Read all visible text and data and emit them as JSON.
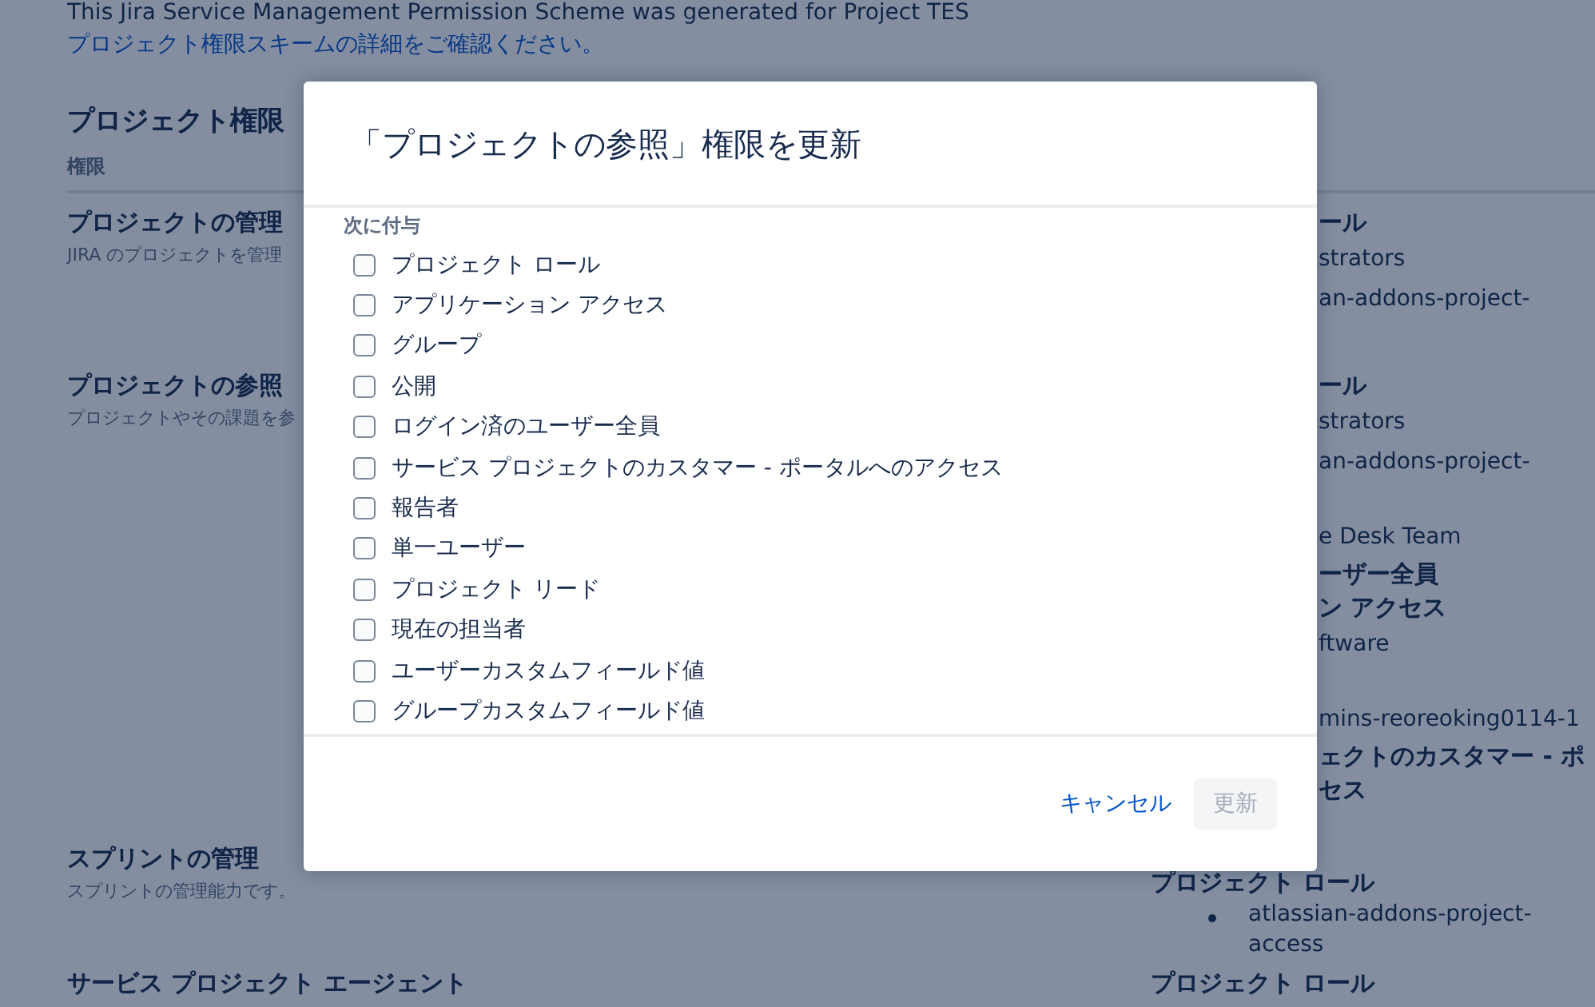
{
  "page": {
    "notice": "This Jira Service Management Permission Scheme was generated for Project TES",
    "notice_link": "プロジェクト権限スキームの詳細をご確認ください。",
    "heading": "プロジェクト権限",
    "column_header": "権限",
    "permissions": [
      {
        "name": "プロジェクトの管理",
        "description": "JIRA のプロジェクトを管理",
        "grants": [
          {
            "kind": "bold",
            "text": "ール"
          },
          {
            "kind": "plain",
            "text": "strators"
          },
          {
            "kind": "plain",
            "text": "an-addons-project-"
          }
        ]
      },
      {
        "name": "プロジェクトの参照",
        "description": "プロジェクトやその課題を参",
        "grants": [
          {
            "kind": "bold",
            "text": "ール"
          },
          {
            "kind": "plain",
            "text": "strators"
          },
          {
            "kind": "plain",
            "text": "an-addons-project-"
          },
          {
            "kind": "gap"
          },
          {
            "kind": "plain",
            "text": "e Desk Team"
          },
          {
            "kind": "bold",
            "text": "ーザー全員"
          },
          {
            "kind": "bold",
            "text": "ン アクセス"
          },
          {
            "kind": "plain",
            "text": "ftware"
          },
          {
            "kind": "gap"
          },
          {
            "kind": "plain",
            "text": "mins-reoreoking0114-1"
          },
          {
            "kind": "bold",
            "text": "ェクトのカスタマー - ポ"
          },
          {
            "kind": "bold",
            "text": "セス"
          }
        ]
      },
      {
        "name": "スプリントの管理",
        "description": "スプリントの管理能力です。",
        "grants": [
          {
            "kind": "bold",
            "text": "プロジェクト ロール"
          },
          {
            "kind": "bullet",
            "text": "atlassian-addons-project-access"
          }
        ]
      },
      {
        "name": "サービス プロジェクト エージェント",
        "grants": [
          {
            "kind": "bold",
            "text": "プロジェクト ロール"
          }
        ]
      }
    ]
  },
  "dialog": {
    "title": "「プロジェクトの参照」権限を更新",
    "section_label": "次に付与",
    "options": [
      {
        "label": "プロジェクト ロール",
        "checked": false
      },
      {
        "label": "アプリケーション アクセス",
        "checked": false
      },
      {
        "label": "グループ",
        "checked": false
      },
      {
        "label": "公開",
        "checked": false
      },
      {
        "label": "ログイン済のユーザー全員",
        "checked": false
      },
      {
        "label": "サービス プロジェクトのカスタマー - ポータルへのアクセス",
        "checked": false
      },
      {
        "label": "報告者",
        "checked": false
      },
      {
        "label": "単一ユーザー",
        "checked": false
      },
      {
        "label": "プロジェクト リード",
        "checked": false
      },
      {
        "label": "現在の担当者",
        "checked": false
      },
      {
        "label": "ユーザーカスタムフィールド値",
        "checked": false
      },
      {
        "label": "グループカスタムフィールド値",
        "checked": false
      }
    ],
    "cancel": "キャンセル",
    "submit": "更新",
    "submit_disabled": true
  }
}
